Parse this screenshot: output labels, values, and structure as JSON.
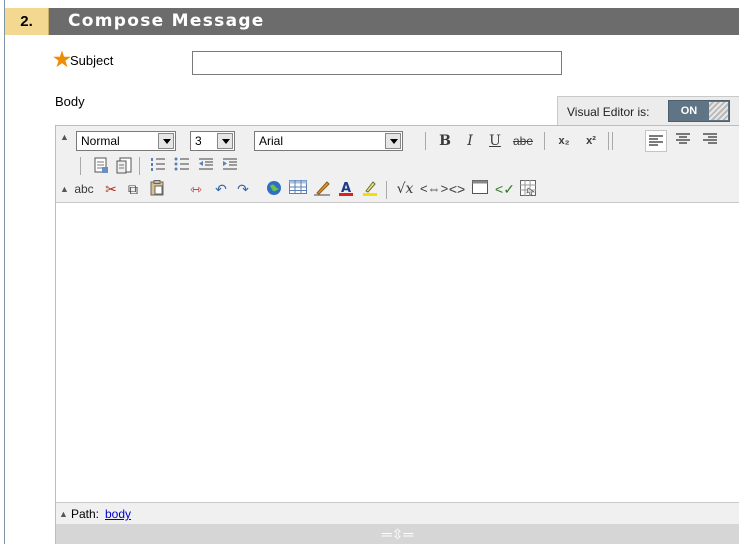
{
  "section": {
    "number": "2.",
    "title": "Compose Message"
  },
  "subject": {
    "label": "Subject",
    "value": "",
    "required": true
  },
  "body": {
    "label": "Body"
  },
  "visual_editor": {
    "label": "Visual Editor is:",
    "state": "ON"
  },
  "toolbar": {
    "format_select": "Normal",
    "size_select": "3",
    "font_select": "Arial",
    "bold": "B",
    "italic": "I",
    "underline": "U",
    "strikethrough": "abe",
    "subscript": "x₂",
    "superscript": "x²",
    "spellcheck": "abc"
  },
  "path": {
    "label": "Path:",
    "value": "body"
  },
  "resize_glyph": "═⇳═"
}
